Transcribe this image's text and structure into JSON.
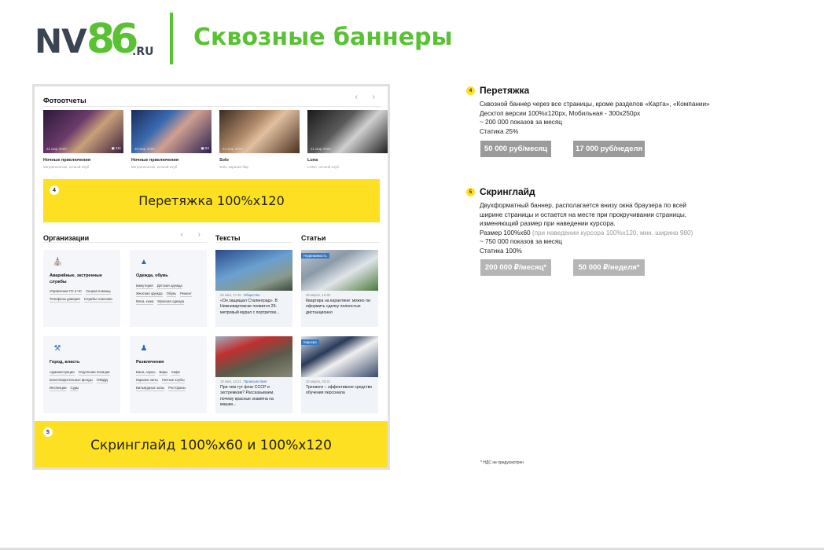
{
  "header": {
    "logo_nv": "NV",
    "logo_86": "86",
    "logo_ru": ".RU",
    "title": "Сквозные баннеры"
  },
  "mockup": {
    "photo_section_title": "Фотоотчеты",
    "photo_arrows": "‹ ›",
    "photos": [
      {
        "date": "21 мар 2020",
        "count": "111",
        "title": "Ночные приключения",
        "subtitle": "Метрополитан, ночной клуб"
      },
      {
        "date": "20 мар 2020",
        "count": "84",
        "title": "Ночные приключения",
        "subtitle": "Метрополитан, ночной клуб"
      },
      {
        "date": "21 мар 2020",
        "count": "",
        "title": "Solo",
        "subtitle": "Solo, караоке бар"
      },
      {
        "date": "21 мар 2020",
        "count": "",
        "title": "Luna",
        "subtitle": "LUNA, ночной клуб"
      }
    ],
    "banner1": {
      "badge": "4",
      "text": "Перетяжка 100%x120"
    },
    "orgs_title": "Организации",
    "orgs_arrows": "‹ ›",
    "texts_title": "Тексты",
    "articles_title": "Статьи",
    "org_cards": [
      {
        "icon": "building-icon",
        "title": "Аварийные, экстренные службы",
        "tags": [
          "Управление ГО и ЧС",
          "Скорая помощь",
          "Телефоны доверия",
          "Службы спасения"
        ]
      },
      {
        "icon": "shirt-icon",
        "title": "Одежда, обувь",
        "tags": [
          "Бижутерия",
          "Детская одежда",
          "Женская одежда",
          "Обувь",
          "Ремонт",
          "Меха, кожа",
          "Мужская одежда"
        ]
      },
      {
        "icon": "gavel-icon",
        "title": "Город, власть",
        "tags": [
          "Администрации",
          "Отделения полиции",
          "Благотворительные фонды",
          "ГИБДД",
          "Инспекции",
          "Суды"
        ]
      },
      {
        "icon": "bowling-icon",
        "title": "Развлечения",
        "tags": [
          "Бани, сауны",
          "Бары",
          "Кафе",
          "Караоке-залы",
          "Ночные клубы",
          "Бильярдные залы",
          "Рестораны"
        ]
      }
    ],
    "news_cards": [
      {
        "date": "26 мая, 17:40",
        "category": "Общество",
        "label": "",
        "text": "«Он защищал Сталинград». В Нижневартовске появится 25-метровый мурал с портретом..."
      },
      {
        "date": "30 марта, 12:38",
        "category": "",
        "label": "Недвижимость",
        "text": "Квартира на карантине: можно ли оформить сделку полностью дистанционно"
      },
      {
        "date": "10 мая, 14:21",
        "category": "Происшествия",
        "label": "",
        "text": "При чем тут флаг СССР и экстремизм? Рассказываем, почему красные знамёна на машин..."
      },
      {
        "date": "22 марта, 20:31",
        "category": "",
        "label": "Карьера",
        "text": "Тренинги – эффективное средство обучения персонала"
      }
    ],
    "banner2": {
      "badge": "5",
      "text": "Скринглайд 100%x60 и 100%x120"
    }
  },
  "info": {
    "block4": {
      "num": "4",
      "title": "Перетяжка",
      "lines": [
        "Сквозной баннер через все страницы, кроме разделов «Карта», «Компании»",
        "Десктоп версии 100%x120px, Мобильная - 300x250px",
        "~ 200 000 показов за месяц",
        "Статика 25%"
      ],
      "price_month": "50 000 руб/месяц",
      "price_week": "17 000 руб/неделя"
    },
    "block5": {
      "num": "5",
      "title": "Скринглайд",
      "lines": [
        "Двухформатный баннер, располагается внизу окна браузера по всей",
        "ширине страницы и остается на месте при прокручивании страницы,",
        "изменяющий размер при наведении курсора.",
        "Размер 100%x60"
      ],
      "size_note": " (при наведении курсора 100%x120, мин. ширина 980)",
      "lines_after": [
        "~ 750 000 показов за месяц",
        "Статика 100%"
      ],
      "price_month": "200 000 ₽/месяц*",
      "price_week": "50 000 ₽/неделя*"
    },
    "vat_note": "* НДС не предусмотрен"
  }
}
